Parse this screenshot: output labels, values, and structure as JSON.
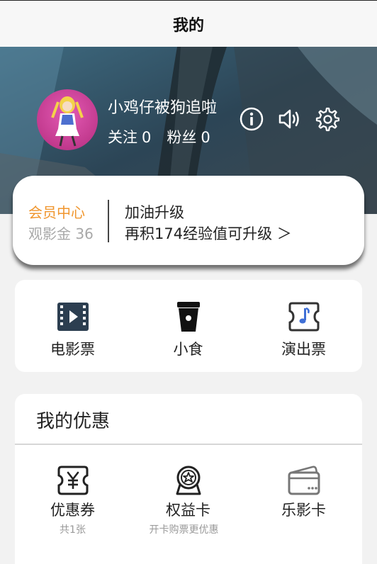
{
  "header": {
    "title": "我的"
  },
  "profile": {
    "username": "小鸡仔被狗追啦",
    "follow_label": "关注",
    "follow_count": "0",
    "fans_label": "粉丝",
    "fans_count": "0",
    "icons": [
      "info-icon",
      "sound-icon",
      "settings-icon"
    ]
  },
  "member": {
    "center_label": "会员中心",
    "coin_text": "观影金 36",
    "upgrade_title": "加油升级",
    "upgrade_desc": "再积174经验值可升级 ＞"
  },
  "services": [
    {
      "label": "电影票",
      "icon": "film-icon"
    },
    {
      "label": "小食",
      "icon": "cup-icon"
    },
    {
      "label": "演出票",
      "icon": "music-ticket-icon"
    }
  ],
  "coupons": {
    "title": "我的优惠",
    "items": [
      {
        "label": "优惠券",
        "sub": "共1张",
        "icon": "yen-ticket-icon"
      },
      {
        "label": "权益卡",
        "sub": "开卡购票更优惠",
        "icon": "medal-icon"
      },
      {
        "label": "乐影卡",
        "sub": "",
        "icon": "card-icon"
      }
    ]
  },
  "colors": {
    "accent_orange": "#f0962e",
    "muted_gray": "#a8a8a8",
    "music_blue": "#3f6fd6"
  }
}
